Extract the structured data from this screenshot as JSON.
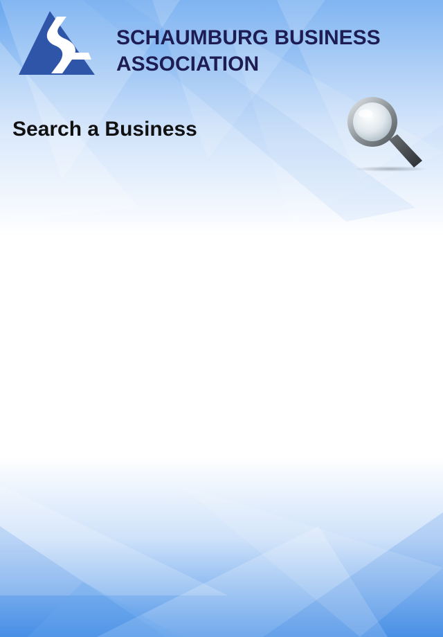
{
  "header": {
    "org_name_line1": "SCHAUMBURG BUSINESS",
    "org_name_line2": "ASSOCIATION",
    "logo_icon": "sba-logo-icon"
  },
  "search": {
    "title": "Search a Business",
    "button_icon": "magnifier-icon"
  },
  "colors": {
    "accent_blue": "#2f55a8",
    "title_navy": "#1d1d54",
    "bg_light_blue": "#7fb4ee"
  }
}
